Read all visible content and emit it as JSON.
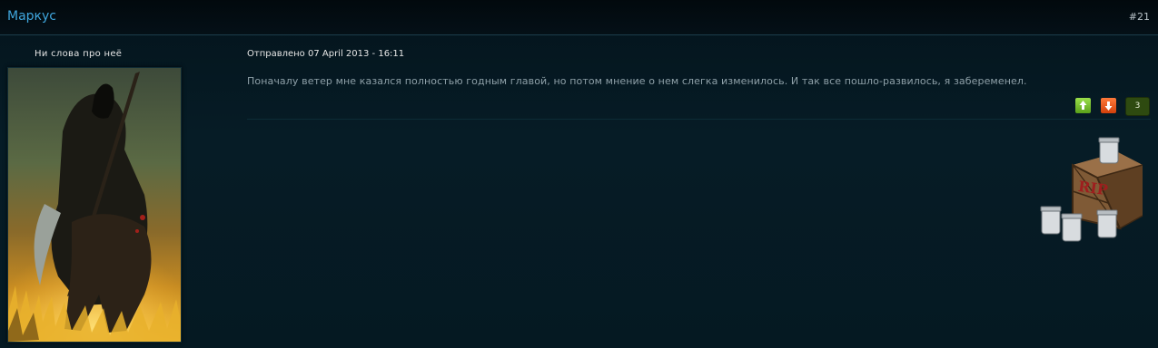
{
  "author": {
    "name": "Маркус",
    "status": "Ни слова про неё"
  },
  "post": {
    "number": "#21",
    "date": "Отправлено 07 April 2013 - 16:11",
    "body": "Поначалу ветер мне казался полностью годным главой, но потом мнение о нем слегка изменилось. И так все пошло-развилось, я забеременел."
  },
  "reputation": {
    "count": "3",
    "up_icon": "arrow-up-icon",
    "down_icon": "arrow-down-icon",
    "up_color": "#7ec63a",
    "down_color": "#e85a1c",
    "count_bg": "#2e4a10"
  },
  "signature": {
    "text": "RIP"
  },
  "colors": {
    "author_link": "#3fa6dd",
    "background": "#041820"
  }
}
